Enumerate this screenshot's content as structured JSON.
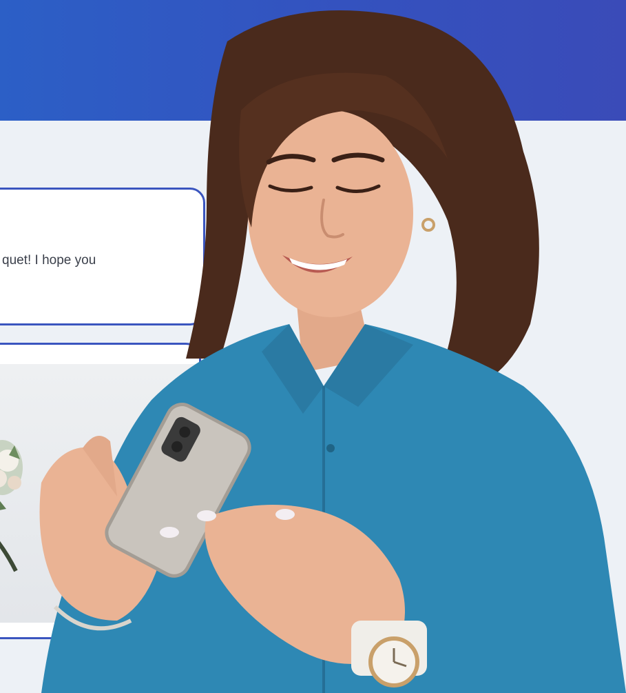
{
  "message": {
    "text": "quet! I hope you"
  },
  "image_card": {
    "icon": "flower-bouquet"
  },
  "photo": {
    "subject": "person-holding-smartphone-icon"
  },
  "colors": {
    "header_band": "#3452bf",
    "background": "#edf1f6",
    "bubble_border": "#3a55bf",
    "shirt": "#2e88b4",
    "hair": "#4a2a1c"
  }
}
